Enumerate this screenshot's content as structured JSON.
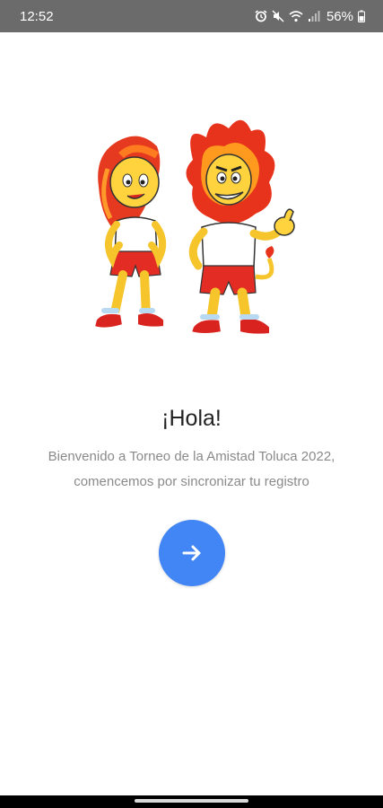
{
  "status_bar": {
    "time": "12:52",
    "battery": "56%",
    "icons": [
      "alarm-icon",
      "mute-icon",
      "wifi-icon",
      "signal-icon",
      "battery-icon"
    ]
  },
  "illustration": {
    "name": "mascots"
  },
  "main": {
    "greeting": "¡Hola!",
    "welcome": "Bienvenido a Torneo de la Amistad Toluca 2022, comencemos por sincronizar tu registro",
    "next_icon": "arrow-right-icon"
  },
  "colors": {
    "accent": "#4285f4",
    "status_bar": "#6b6b6b",
    "text_primary": "#222222",
    "text_secondary": "#8a8a8a"
  }
}
